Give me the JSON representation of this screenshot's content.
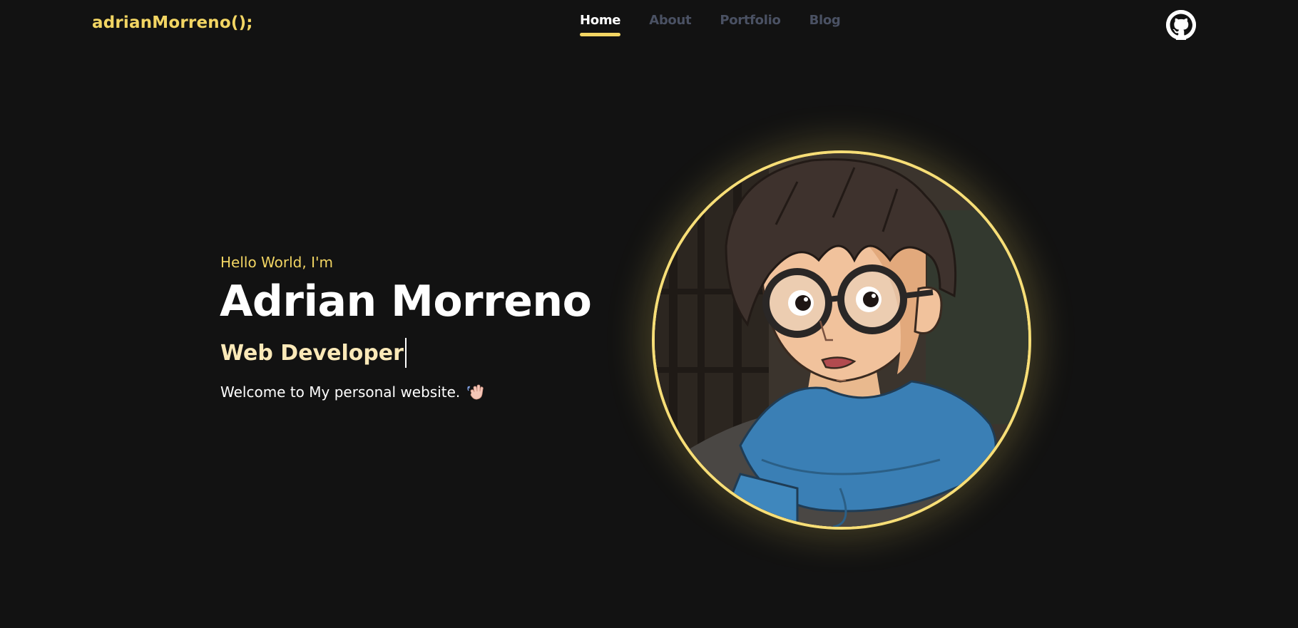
{
  "header": {
    "logo": "adrianMorreno();",
    "nav": [
      {
        "label": "Home",
        "active": true
      },
      {
        "label": "About",
        "active": false
      },
      {
        "label": "Portfolio",
        "active": false
      },
      {
        "label": "Blog",
        "active": false
      }
    ],
    "github_icon": "github-icon"
  },
  "hero": {
    "greeting": "Hello World, I'm",
    "name": "Adrian Morreno",
    "role": "Web Developer",
    "welcome": "Welcome to My personal website.",
    "wave_icon": "waving-hand-icon"
  },
  "avatar": {
    "icon": "anime-boy-with-glasses-portrait"
  },
  "colors": {
    "background": "#121212",
    "accent": "#f2d563",
    "role_text": "#fbe9b8",
    "nav_inactive": "#4a5163",
    "text": "#ffffff"
  }
}
